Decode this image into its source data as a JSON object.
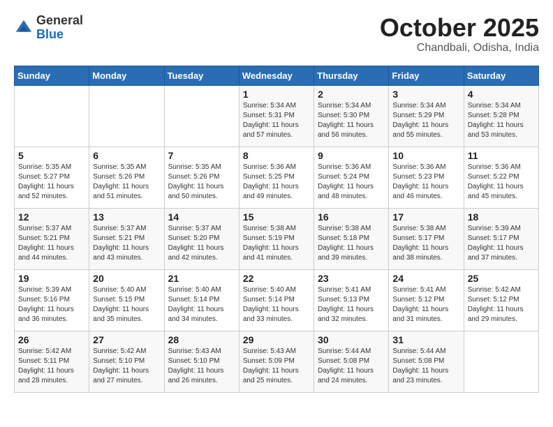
{
  "header": {
    "logo_general": "General",
    "logo_blue": "Blue",
    "month_title": "October 2025",
    "location": "Chandbali, Odisha, India"
  },
  "days_of_week": [
    "Sunday",
    "Monday",
    "Tuesday",
    "Wednesday",
    "Thursday",
    "Friday",
    "Saturday"
  ],
  "weeks": [
    [
      {
        "day": "",
        "info": ""
      },
      {
        "day": "",
        "info": ""
      },
      {
        "day": "",
        "info": ""
      },
      {
        "day": "1",
        "info": "Sunrise: 5:34 AM\nSunset: 5:31 PM\nDaylight: 11 hours\nand 57 minutes."
      },
      {
        "day": "2",
        "info": "Sunrise: 5:34 AM\nSunset: 5:30 PM\nDaylight: 11 hours\nand 56 minutes."
      },
      {
        "day": "3",
        "info": "Sunrise: 5:34 AM\nSunset: 5:29 PM\nDaylight: 11 hours\nand 55 minutes."
      },
      {
        "day": "4",
        "info": "Sunrise: 5:34 AM\nSunset: 5:28 PM\nDaylight: 11 hours\nand 53 minutes."
      }
    ],
    [
      {
        "day": "5",
        "info": "Sunrise: 5:35 AM\nSunset: 5:27 PM\nDaylight: 11 hours\nand 52 minutes."
      },
      {
        "day": "6",
        "info": "Sunrise: 5:35 AM\nSunset: 5:26 PM\nDaylight: 11 hours\nand 51 minutes."
      },
      {
        "day": "7",
        "info": "Sunrise: 5:35 AM\nSunset: 5:26 PM\nDaylight: 11 hours\nand 50 minutes."
      },
      {
        "day": "8",
        "info": "Sunrise: 5:36 AM\nSunset: 5:25 PM\nDaylight: 11 hours\nand 49 minutes."
      },
      {
        "day": "9",
        "info": "Sunrise: 5:36 AM\nSunset: 5:24 PM\nDaylight: 11 hours\nand 48 minutes."
      },
      {
        "day": "10",
        "info": "Sunrise: 5:36 AM\nSunset: 5:23 PM\nDaylight: 11 hours\nand 46 minutes."
      },
      {
        "day": "11",
        "info": "Sunrise: 5:36 AM\nSunset: 5:22 PM\nDaylight: 11 hours\nand 45 minutes."
      }
    ],
    [
      {
        "day": "12",
        "info": "Sunrise: 5:37 AM\nSunset: 5:21 PM\nDaylight: 11 hours\nand 44 minutes."
      },
      {
        "day": "13",
        "info": "Sunrise: 5:37 AM\nSunset: 5:21 PM\nDaylight: 11 hours\nand 43 minutes."
      },
      {
        "day": "14",
        "info": "Sunrise: 5:37 AM\nSunset: 5:20 PM\nDaylight: 11 hours\nand 42 minutes."
      },
      {
        "day": "15",
        "info": "Sunrise: 5:38 AM\nSunset: 5:19 PM\nDaylight: 11 hours\nand 41 minutes."
      },
      {
        "day": "16",
        "info": "Sunrise: 5:38 AM\nSunset: 5:18 PM\nDaylight: 11 hours\nand 39 minutes."
      },
      {
        "day": "17",
        "info": "Sunrise: 5:38 AM\nSunset: 5:17 PM\nDaylight: 11 hours\nand 38 minutes."
      },
      {
        "day": "18",
        "info": "Sunrise: 5:39 AM\nSunset: 5:17 PM\nDaylight: 11 hours\nand 37 minutes."
      }
    ],
    [
      {
        "day": "19",
        "info": "Sunrise: 5:39 AM\nSunset: 5:16 PM\nDaylight: 11 hours\nand 36 minutes."
      },
      {
        "day": "20",
        "info": "Sunrise: 5:40 AM\nSunset: 5:15 PM\nDaylight: 11 hours\nand 35 minutes."
      },
      {
        "day": "21",
        "info": "Sunrise: 5:40 AM\nSunset: 5:14 PM\nDaylight: 11 hours\nand 34 minutes."
      },
      {
        "day": "22",
        "info": "Sunrise: 5:40 AM\nSunset: 5:14 PM\nDaylight: 11 hours\nand 33 minutes."
      },
      {
        "day": "23",
        "info": "Sunrise: 5:41 AM\nSunset: 5:13 PM\nDaylight: 11 hours\nand 32 minutes."
      },
      {
        "day": "24",
        "info": "Sunrise: 5:41 AM\nSunset: 5:12 PM\nDaylight: 11 hours\nand 31 minutes."
      },
      {
        "day": "25",
        "info": "Sunrise: 5:42 AM\nSunset: 5:12 PM\nDaylight: 11 hours\nand 29 minutes."
      }
    ],
    [
      {
        "day": "26",
        "info": "Sunrise: 5:42 AM\nSunset: 5:11 PM\nDaylight: 11 hours\nand 28 minutes."
      },
      {
        "day": "27",
        "info": "Sunrise: 5:42 AM\nSunset: 5:10 PM\nDaylight: 11 hours\nand 27 minutes."
      },
      {
        "day": "28",
        "info": "Sunrise: 5:43 AM\nSunset: 5:10 PM\nDaylight: 11 hours\nand 26 minutes."
      },
      {
        "day": "29",
        "info": "Sunrise: 5:43 AM\nSunset: 5:09 PM\nDaylight: 11 hours\nand 25 minutes."
      },
      {
        "day": "30",
        "info": "Sunrise: 5:44 AM\nSunset: 5:08 PM\nDaylight: 11 hours\nand 24 minutes."
      },
      {
        "day": "31",
        "info": "Sunrise: 5:44 AM\nSunset: 5:08 PM\nDaylight: 11 hours\nand 23 minutes."
      },
      {
        "day": "",
        "info": ""
      }
    ]
  ]
}
